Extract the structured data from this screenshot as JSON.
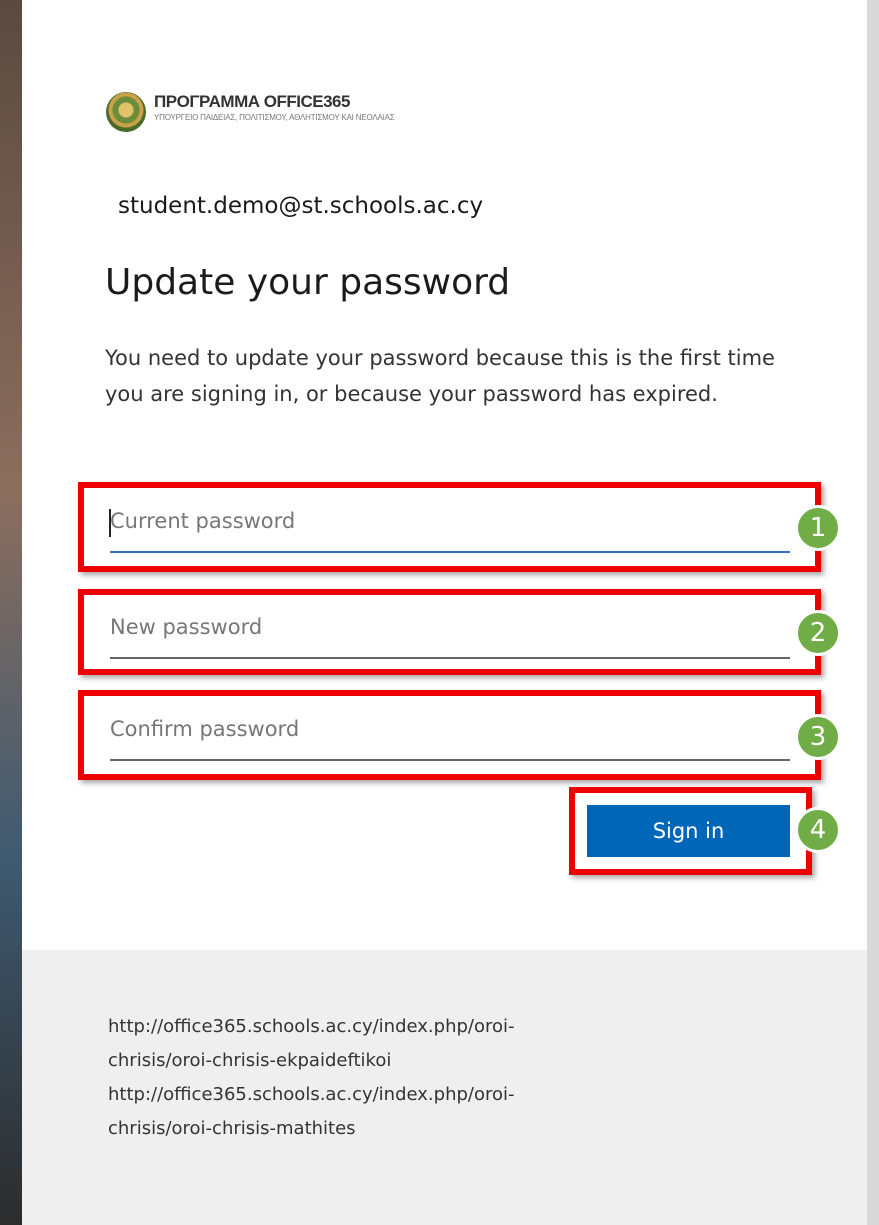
{
  "logo": {
    "title": "ΠΡΟΓΡΑΜΜΑ OFFICE365",
    "subtitle": "ΥΠΟΥΡΓΕΙΟ ΠΑΙΔΕΙΑΣ, ΠΟΛΙΤΙΣΜΟΥ, ΑΘΛΗΤΙΣΜΟΥ ΚΑΙ ΝΕΟΛΑΙΑΣ"
  },
  "account_email": "student.demo@st.schools.ac.cy",
  "heading": "Update your password",
  "description": "You need to update your password because this is the first time you are signing in, or because your password has expired.",
  "fields": {
    "current": {
      "placeholder": "Current password",
      "value": ""
    },
    "new": {
      "placeholder": "New password",
      "value": ""
    },
    "confirm": {
      "placeholder": "Confirm password",
      "value": ""
    }
  },
  "signin_label": "Sign in",
  "step_badges": [
    "1",
    "2",
    "3",
    "4"
  ],
  "footer_links": [
    "http://office365.schools.ac.cy/index.php/oroi-",
    "chrisis/oroi-chrisis-ekpaideftikoi",
    "http://office365.schools.ac.cy/index.php/oroi-",
    "chrisis/oroi-chrisis-mathites"
  ],
  "colors": {
    "highlight": "#ee0000",
    "badge": "#70ad47",
    "button": "#0067b8",
    "focus_underline": "#2f6fc4"
  }
}
